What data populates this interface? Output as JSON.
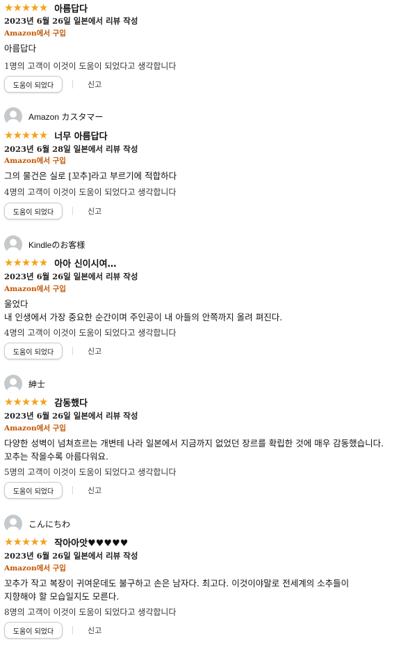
{
  "reviews": [
    {
      "reviewer": "",
      "stars": 5,
      "title": "아름답다",
      "date": "2023년 6월 26일 일본에서 리뷰 작성",
      "verified": "Amazon에서 구입",
      "body": [
        "아름답다"
      ],
      "helpful": "1명의 고객이 이것이 도움이 되었다고 생각합니다",
      "helpful_button": "도움이 되었다",
      "report": "신고"
    },
    {
      "reviewer": "Amazon カスタマー",
      "stars": 5,
      "title": "너무 아름답다",
      "date": "2023년 6월 28일 일본에서 리뷰 작성",
      "verified": "Amazon에서 구입",
      "body": [
        "그의 물건은 실로 [꼬추]라고 부르기에 적합하다"
      ],
      "helpful": "4명의 고객이 이것이 도움이 되었다고 생각합니다",
      "helpful_button": "도움이 되었다",
      "report": "신고"
    },
    {
      "reviewer": "Kindleのお客様",
      "stars": 5,
      "title": "아아 신이시여…",
      "date": "2023년 6월 26일 일본에서 리뷰 작성",
      "verified": "Amazon에서 구입",
      "body": [
        "울었다",
        "내 인생에서 가장 중요한 순간이며 주인공이 내 아들의 안쪽까지 올려 펴진다."
      ],
      "helpful": "4명의 고객이 이것이 도움이 되었다고 생각합니다",
      "helpful_button": "도움이 되었다",
      "report": "신고"
    },
    {
      "reviewer": "紳士",
      "stars": 5,
      "title": "감동했다",
      "date": "2023년 6월 26일 일본에서 리뷰 작성",
      "verified": "Amazon에서 구입",
      "body": [
        "다양한 성벽이 넘쳐흐르는 개변테 나라 일본에서 지금까지 없었던 장르를 확립한 것에 매우 감동했습니다.",
        "꼬추는 작을수록 아름다워요."
      ],
      "helpful": "5명의 고객이 이것이 도움이 되었다고 생각합니다",
      "helpful_button": "도움이 되었다",
      "report": "신고"
    },
    {
      "reviewer": "こんにちわ",
      "stars": 5,
      "title": "작아아앗♥♥♥♥♥",
      "date": "2023년 6월 26일 일본에서 리뷰 작성",
      "verified": "Amazon에서 구입",
      "body": [
        "꼬추가 작고 복장이 귀여운데도 불구하고 손은 남자다. 최고다. 이것이야말로 전세계의 소추들이",
        "지향해야 할 모습일지도 모른다."
      ],
      "helpful": "8명의 고객이 이것이 도움이 되었다고 생각합니다",
      "helpful_button": "도움이 되었다",
      "report": "신고"
    }
  ],
  "colors": {
    "star": "#f2a31b",
    "verified": "#c45500",
    "avatar": "#c5c9cc"
  }
}
